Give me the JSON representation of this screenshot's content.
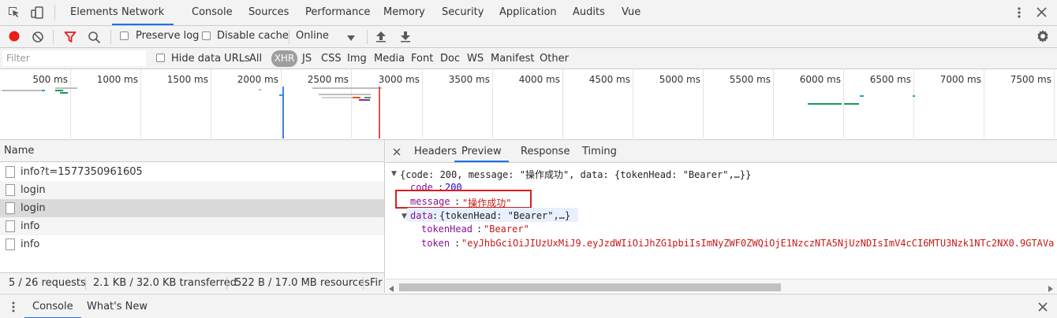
{
  "top_tabs": [
    "Elements",
    "Network",
    "Console",
    "Sources",
    "Performance",
    "Memory",
    "Security",
    "Application",
    "Audits",
    "Vue"
  ],
  "active_top_tab": "Network",
  "toolbar": {
    "preserve_log_label": "Preserve log",
    "disable_cache_label": "Disable cache",
    "throttle_value": "Online"
  },
  "filter_bar": {
    "placeholder": "Filter",
    "hide_data_urls_label": "Hide data URLs",
    "types": [
      "All",
      "XHR",
      "JS",
      "CSS",
      "Img",
      "Media",
      "Font",
      "Doc",
      "WS",
      "Manifest",
      "Other"
    ],
    "selected_type": "XHR"
  },
  "overview": {
    "ticks": [
      "500 ms",
      "1000 ms",
      "1500 ms",
      "2000 ms",
      "2500 ms",
      "3000 ms",
      "3500 ms",
      "4000 ms",
      "4500 ms",
      "5000 ms",
      "5500 ms",
      "6000 ms",
      "6500 ms",
      "7000 ms",
      "7500 ms"
    ],
    "blue_line_ms": 2000,
    "red_line_ms": 2700
  },
  "requests": {
    "column_header": "Name",
    "rows": [
      {
        "name": "info?t=1577350961605"
      },
      {
        "name": "login"
      },
      {
        "name": "login"
      },
      {
        "name": "info"
      },
      {
        "name": "info"
      }
    ],
    "selected_index": 2
  },
  "status": {
    "requests": "5 / 26 requests",
    "transferred": "2.1 KB / 32.0 KB transferred",
    "resources": "522 B / 17.0 MB resources",
    "finish": "Fir"
  },
  "detail_tabs": [
    "Headers",
    "Preview",
    "Response",
    "Timing"
  ],
  "active_detail_tab": "Preview",
  "preview": {
    "summary": "{code: 200, message: \"操作成功\", data: {tokenHead: \"Bearer\",…}}",
    "code_key": "code",
    "code_value": "200",
    "message_key": "message",
    "message_value": "\"操作成功\"",
    "data_key": "data",
    "data_summary": "{tokenHead: \"Bearer\",…}",
    "tokenHead_key": "tokenHead",
    "tokenHead_value": "\"Bearer\"",
    "token_key": "token",
    "token_value": "\"eyJhbGciOiJIUzUxMiJ9.eyJzdWIiOiJhZG1pbiIsImNyZWF0ZWQiOjE1NzczNTA5NjUzNDIsImV4cCI6MTU3Nzk1NTc2NX0.9GTAVa"
  },
  "drawer_tabs": [
    "Console",
    "What's New"
  ],
  "active_drawer_tab": "Console"
}
